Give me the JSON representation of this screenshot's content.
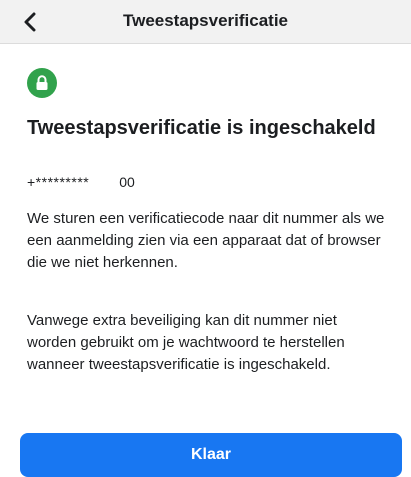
{
  "header": {
    "title": "Tweestapsverificatie",
    "back_icon": "chevron-left-icon"
  },
  "status": {
    "icon": "lock-icon",
    "badge_color": "#31a24c"
  },
  "main": {
    "title": "Tweestapsverificatie is ingeschakeld",
    "phone_masked": "+*********",
    "phone_suffix": "00",
    "paragraph_1": "We sturen een verificatiecode naar dit nummer als we een aanmelding zien via een apparaat dat of browser die we niet herkennen.",
    "paragraph_2": "Vanwege extra beveiliging kan dit nummer niet worden gebruikt om je wachtwoord te herstellen wanneer tweestapsverificatie is ingeschakeld."
  },
  "footer": {
    "done_label": "Klaar",
    "button_color": "#1877f2"
  }
}
